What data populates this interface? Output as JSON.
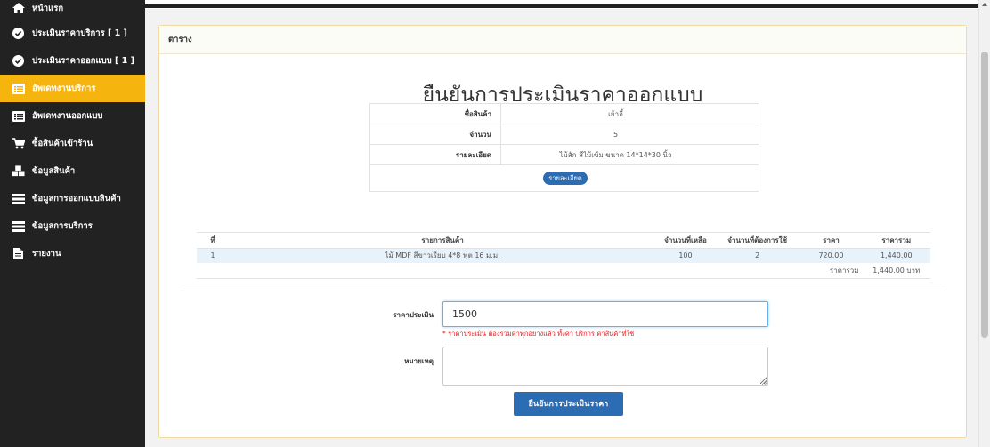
{
  "sidebar": {
    "items": [
      {
        "label": "หน้าแรก",
        "icon": "home-icon"
      },
      {
        "label": "ประเมินราคาบริการ [ 1 ]",
        "icon": "check-circle-icon"
      },
      {
        "label": "ประเมินราคาออกแบบ [ 1 ]",
        "icon": "check-circle-icon"
      },
      {
        "label": "อัพเดทงานบริการ",
        "icon": "list-icon"
      },
      {
        "label": "อัพเดทงานออกแบบ",
        "icon": "list-icon"
      },
      {
        "label": "ซื้อสินค้าเข้าร้าน",
        "icon": "cart-icon"
      },
      {
        "label": "ข้อมูลสินค้า",
        "icon": "cubes-icon"
      },
      {
        "label": "ข้อมูลการออกแบบสินค้า",
        "icon": "table-icon"
      },
      {
        "label": "ข้อมูลการบริการ",
        "icon": "table-icon"
      },
      {
        "label": "รายงาน",
        "icon": "file-icon"
      }
    ],
    "active_index": 3,
    "active_color": "#f6b40e"
  },
  "panel": {
    "heading": "ตาราง"
  },
  "page_title": "ยืนยันการประเมินราคาออกแบบ",
  "detail": {
    "rows": [
      {
        "label": "ชื่อสินค้า",
        "value": "เก้าอี้"
      },
      {
        "label": "จำนวน",
        "value": "5"
      },
      {
        "label": "รายละเอียด",
        "value": "ไม้สัก สีไม้เข้ม ขนาด 14*14*30 นิ้ว"
      }
    ],
    "button_label": "รายละเอียด"
  },
  "items_table": {
    "headers": [
      "ที่",
      "รายการสินค้า",
      "จำนวนที่เหลือ",
      "จำนวนที่ต้องการใช้",
      "ราคา",
      "ราคารวม"
    ],
    "rows": [
      [
        "1",
        "ไม้ MDF สีขาวเรียบ 4*8 ฟุต 16 ม.ม.",
        "100",
        "2",
        "720.00",
        "1,440.00"
      ]
    ],
    "total_label": "ราคารวม",
    "total_value": "1,440.00 บาท"
  },
  "form": {
    "price_label": "ราคาประเมิน",
    "price_value": "1500",
    "price_hint": "* ราคาประเมิน ต้องรวมค่าทุกอย่างแล้ว ทั้งค่า บริการ ค่าสินค้าที่ใช้",
    "note_label": "หมายเหตุ",
    "note_value": "",
    "submit_label": "ยืนยันการประเมินราคา"
  },
  "colors": {
    "sidebar_bg": "#222222",
    "primary_button": "#2b6cb3",
    "hint_text": "#e02020"
  }
}
